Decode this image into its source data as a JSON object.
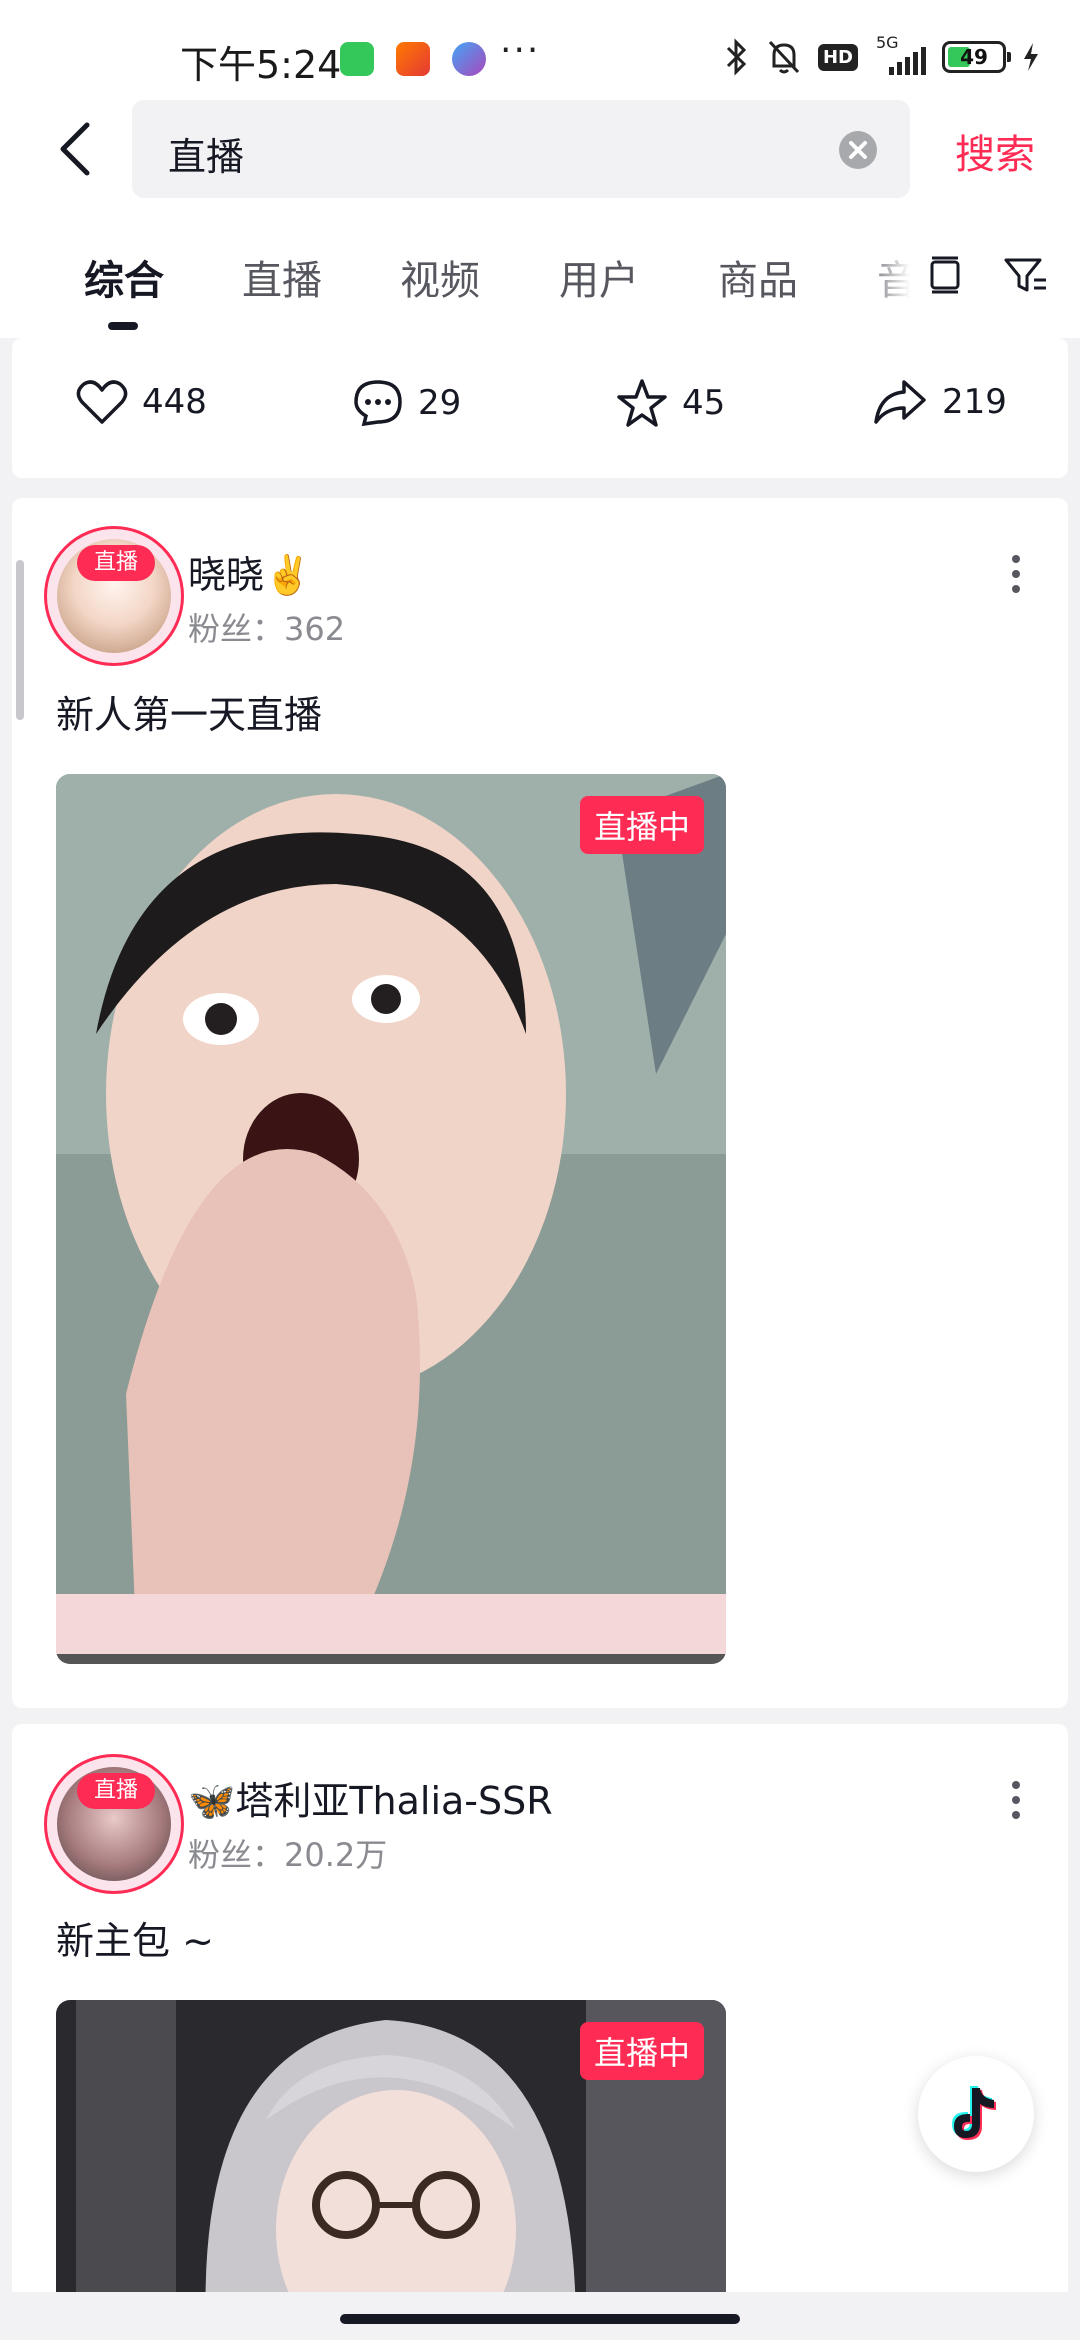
{
  "status_bar": {
    "time": "下午5:24",
    "dots": "···",
    "app_icons": [
      "messaging-app-icon",
      "58-app-icon",
      "cloud-app-icon"
    ],
    "hd_label": "HD",
    "network_label": "5G",
    "battery_level": "49"
  },
  "search": {
    "query": "直播",
    "submit_label": "搜索"
  },
  "tabs": {
    "items": [
      {
        "label": "综合"
      },
      {
        "label": "直播"
      },
      {
        "label": "视频"
      },
      {
        "label": "用户"
      },
      {
        "label": "商品"
      },
      {
        "label": "音"
      }
    ],
    "active_index": 0
  },
  "previous_card": {
    "likes": "448",
    "comments": "29",
    "favorites": "45",
    "shares": "219"
  },
  "live_posts": [
    {
      "live_tag": "直播",
      "author_name": "晓晓✌️",
      "fans": "粉丝：362",
      "description": "新人第一天直播",
      "badge": "直播中"
    },
    {
      "live_tag": "直播",
      "author_name": "🦋塔利亚Thalia-SSR",
      "fans": "粉丝：20.2万",
      "description": "新主包 ~",
      "badge": "直播中"
    }
  ],
  "colors": {
    "accent": "#fe2c55",
    "text_primary": "#161823",
    "text_secondary": "#8a8b91",
    "background": "#f2f2f4"
  }
}
